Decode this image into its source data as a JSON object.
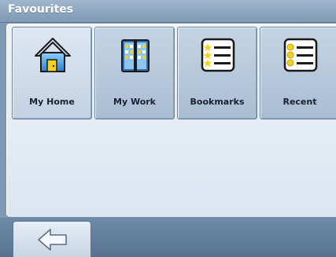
{
  "window": {
    "title": "Favourites"
  },
  "tiles": [
    {
      "label": "My Home",
      "icon": "home-icon"
    },
    {
      "label": "My Work",
      "icon": "office-building-icon"
    },
    {
      "label": "Bookmarks",
      "icon": "bookmarks-list-icon"
    },
    {
      "label": "Recent",
      "icon": "recent-list-icon"
    }
  ],
  "footer": {
    "back_icon": "back-arrow-icon"
  },
  "colors": {
    "title_bar": "#8aa3bd",
    "panel": "#e4ebf4",
    "tile": "#b7c8da",
    "footer": "#6a86a2"
  }
}
